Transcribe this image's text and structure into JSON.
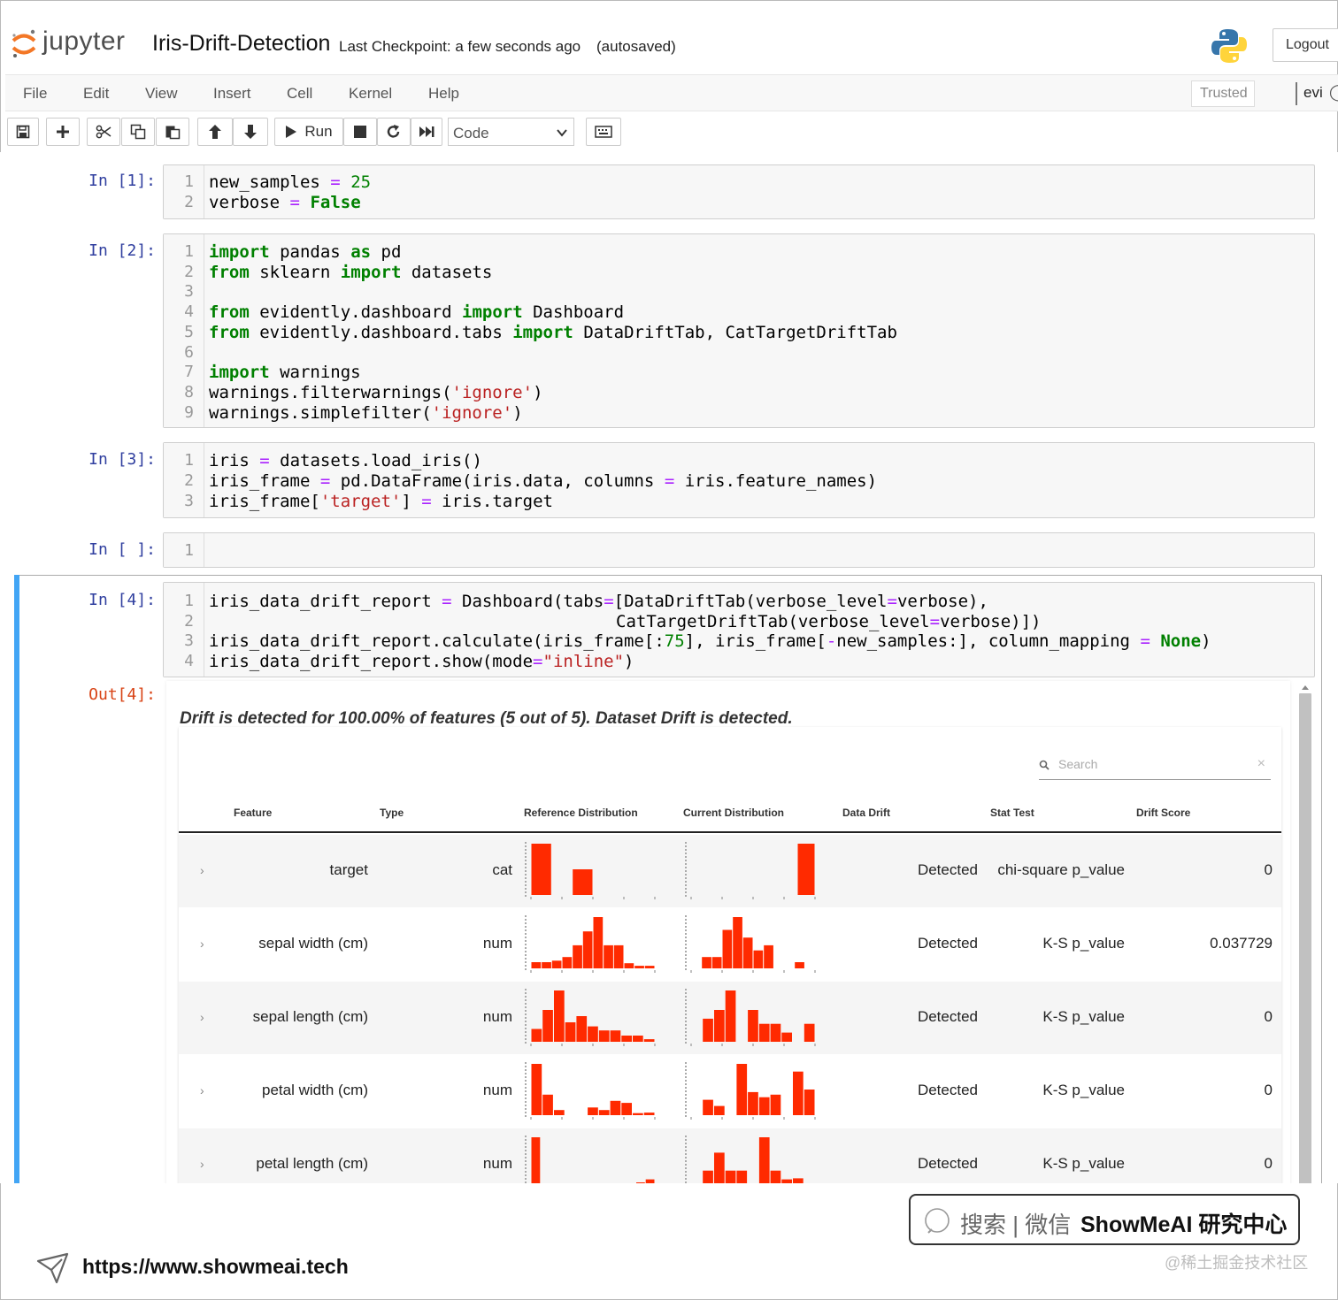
{
  "header": {
    "logo_text": "jupyter",
    "notebook_title": "Iris-Drift-Detection",
    "checkpoint": "Last Checkpoint: a few seconds ago",
    "autosave": "(autosaved)",
    "logout_label": "Logout"
  },
  "menubar": {
    "items": [
      "File",
      "Edit",
      "View",
      "Insert",
      "Cell",
      "Kernel",
      "Help"
    ],
    "trusted_label": "Trusted",
    "kernel_name": "evi"
  },
  "toolbar": {
    "run_label": "Run",
    "cell_type": "Code",
    "icons": [
      "save-icon",
      "plus-icon",
      "cut-icon",
      "copy-icon",
      "paste-icon",
      "arrow-up-icon",
      "arrow-down-icon",
      "play-icon",
      "stop-icon",
      "restart-icon",
      "fast-forward-icon",
      "keyboard-icon"
    ]
  },
  "cells": [
    {
      "prompt": "In [1]:",
      "lines": [
        "1",
        "2"
      ]
    },
    {
      "prompt": "In [2]:",
      "lines": [
        "1",
        "2",
        "3",
        "4",
        "5",
        "6",
        "7",
        "8",
        "9"
      ]
    },
    {
      "prompt": "In [3]:",
      "lines": [
        "1",
        "2",
        "3"
      ]
    },
    {
      "prompt": "In [ ]:",
      "lines": [
        "1"
      ]
    },
    {
      "prompt": "In [4]:",
      "lines": [
        "1",
        "2",
        "3",
        "4"
      ],
      "out_prompt": "Out[4]:"
    }
  ],
  "code": {
    "c1": {
      "l1": [
        "new_samples",
        "=",
        "25"
      ],
      "l2": [
        "verbose",
        "=",
        "False"
      ]
    },
    "c2": {
      "l1": [
        "import",
        "pandas",
        "as",
        "pd"
      ],
      "l2": [
        "from",
        "sklearn",
        "import",
        "datasets"
      ],
      "l4": [
        "from",
        "evidently.dashboard",
        "import",
        "Dashboard"
      ],
      "l5": [
        "from",
        "evidently.dashboard.tabs",
        "import",
        "DataDriftTab, CatTargetDriftTab"
      ],
      "l7": [
        "import",
        "warnings"
      ],
      "l8": [
        "warnings.filterwarnings(",
        "'ignore'",
        ")"
      ],
      "l9": [
        "warnings.simplefilter(",
        "'ignore'",
        ")"
      ]
    },
    "c3": {
      "l1": [
        "iris",
        "=",
        "datasets.load_iris()"
      ],
      "l2": [
        "iris_frame",
        "=",
        "pd.DataFrame(iris.data, columns",
        "=",
        "iris.feature_names)"
      ],
      "l3": [
        "iris_frame[",
        "'target'",
        "]",
        "=",
        "iris.target"
      ]
    },
    "c5": {
      "l1": [
        "iris_data_drift_report",
        "=",
        "Dashboard(tabs",
        "=",
        "[DataDriftTab(verbose_level",
        "=",
        "verbose),"
      ],
      "l2": [
        "CatTargetDriftTab(verbose_level",
        "=",
        "verbose)])"
      ],
      "l3": [
        "iris_data_drift_report.calculate(iris_frame[:",
        "75",
        "], iris_frame[",
        "-",
        "new_samples:], column_mapping",
        "=",
        "None",
        ")"
      ],
      "l4": [
        "iris_data_drift_report.show(mode",
        "=",
        "\"inline\"",
        ")"
      ]
    }
  },
  "output": {
    "summary": "Drift is detected for 100.00% of features (5 out of 5). Dataset Drift is detected.",
    "search_placeholder": "Search",
    "columns": [
      "Feature",
      "Type",
      "Reference Distribution",
      "Current Distribution",
      "Data Drift",
      "Stat Test",
      "Drift Score"
    ],
    "rows": [
      {
        "feature": "target",
        "type": "cat",
        "drift": "Detected",
        "test": "chi-square p_value",
        "score": "0"
      },
      {
        "feature": "sepal width (cm)",
        "type": "num",
        "drift": "Detected",
        "test": "K-S p_value",
        "score": "0.037729"
      },
      {
        "feature": "sepal length (cm)",
        "type": "num",
        "drift": "Detected",
        "test": "K-S p_value",
        "score": "0"
      },
      {
        "feature": "petal width (cm)",
        "type": "num",
        "drift": "Detected",
        "test": "K-S p_value",
        "score": "0"
      },
      {
        "feature": "petal length (cm)",
        "type": "num",
        "drift": "Detected",
        "test": "K-S p_value",
        "score": "0"
      }
    ],
    "bar_color": "#ff2a00",
    "histograms": {
      "ref": [
        [
          1,
          0,
          0.5,
          0,
          0,
          0
        ],
        [
          0.12,
          0.12,
          0.15,
          0.22,
          0.45,
          0.72,
          1,
          0.45,
          0.45,
          0.1,
          0.05,
          0.05
        ],
        [
          0.25,
          0.62,
          1,
          0.38,
          0.5,
          0.3,
          0.22,
          0.22,
          0.12,
          0.12,
          0.05
        ],
        [
          1,
          0.4,
          0.1,
          0,
          0,
          0.15,
          0.1,
          0.28,
          0.24,
          0.04,
          0.05
        ],
        [
          1,
          0.1,
          0,
          0,
          0,
          0,
          0,
          0,
          0,
          0,
          0.05,
          0.12,
          0.18
        ]
      ],
      "cur": [
        [
          0,
          0,
          0,
          0,
          0,
          0,
          1
        ],
        [
          0,
          0.22,
          0.22,
          0.75,
          1,
          0.6,
          0.35,
          0.45,
          0,
          0,
          0.12,
          0
        ],
        [
          0,
          0.45,
          0.62,
          1,
          0,
          0.62,
          0.35,
          0.35,
          0.18,
          0,
          0.35
        ],
        [
          0,
          0.3,
          0.18,
          0,
          1,
          0.45,
          0.35,
          0.4,
          0,
          0.85,
          0.5
        ],
        [
          0,
          0.35,
          0.7,
          0.35,
          0.35,
          0,
          1,
          0.35,
          0.18,
          0.2,
          0
        ]
      ]
    }
  },
  "footer": {
    "watermark_text": "搜索 | 微信",
    "watermark_brand": "ShowMeAI 研究中心",
    "url": "https://www.showmeai.tech",
    "credit": "@稀土掘金技术社区"
  }
}
